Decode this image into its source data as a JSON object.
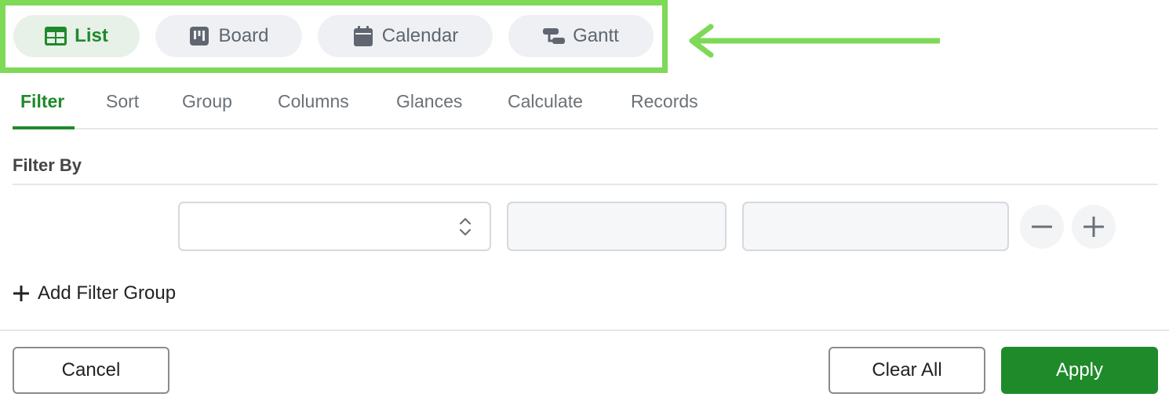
{
  "views": {
    "items": [
      {
        "label": "List",
        "icon": "table-icon",
        "active": true
      },
      {
        "label": "Board",
        "icon": "kanban-icon",
        "active": false
      },
      {
        "label": "Calendar",
        "icon": "calendar-icon",
        "active": false
      },
      {
        "label": "Gantt",
        "icon": "gantt-icon",
        "active": false
      }
    ],
    "highlight_color": "#7ed957"
  },
  "tabs": [
    {
      "label": "Filter",
      "active": true
    },
    {
      "label": "Sort"
    },
    {
      "label": "Group"
    },
    {
      "label": "Columns"
    },
    {
      "label": "Glances"
    },
    {
      "label": "Calculate"
    },
    {
      "label": "Records"
    }
  ],
  "filter": {
    "title": "Filter By",
    "field_value": "",
    "operator_value": "",
    "value_value": "",
    "add_group_label": "Add Filter Group"
  },
  "footer": {
    "cancel_label": "Cancel",
    "clear_all_label": "Clear All",
    "apply_label": "Apply"
  },
  "colors": {
    "accent": "#1f8a2a",
    "annotation": "#7ed957"
  }
}
